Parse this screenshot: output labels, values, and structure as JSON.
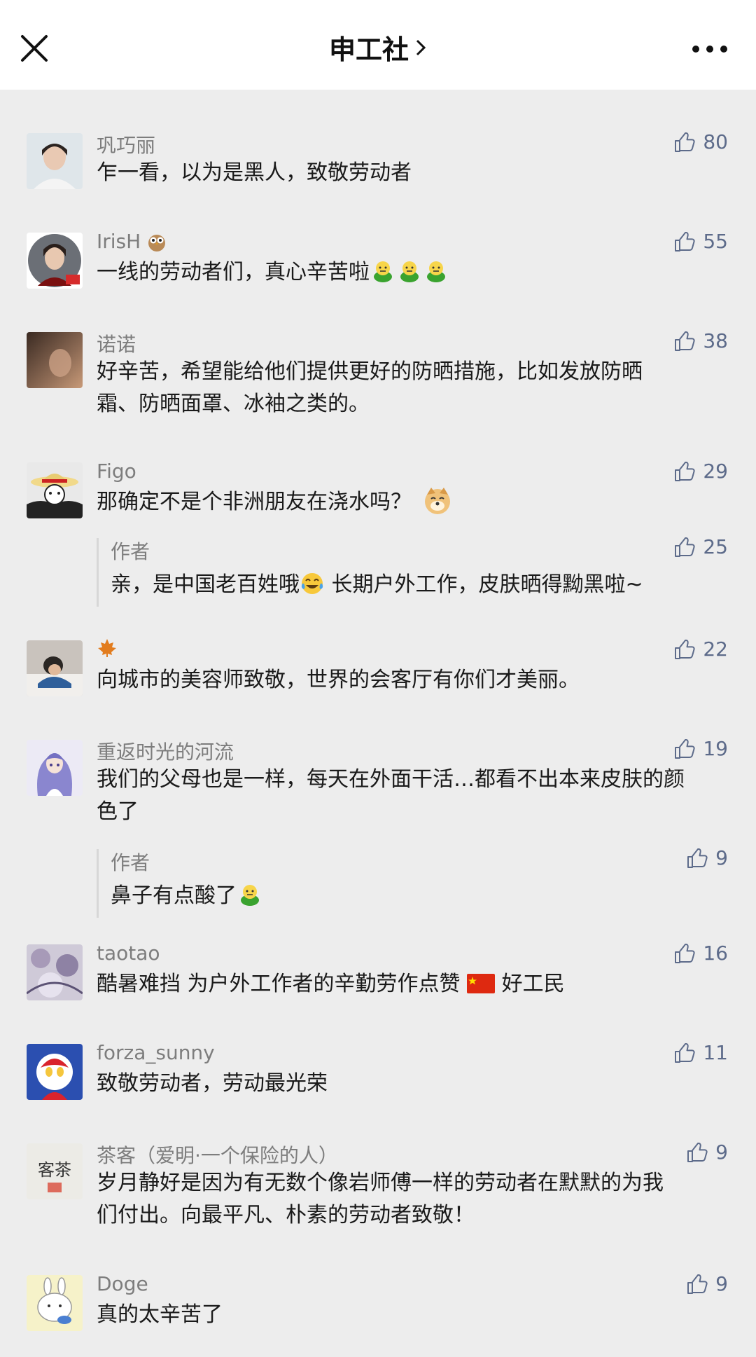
{
  "header": {
    "title": "申工社"
  },
  "comments": [
    {
      "name": "巩巧丽",
      "text": "乍一看，以为是黑人，致敬劳动者",
      "likes": "80"
    },
    {
      "name": "IrisH",
      "text": "一线的劳动者们，真心辛苦啦",
      "likes": "55"
    },
    {
      "name": "诺诺",
      "text1": "好辛苦，希望能给他们提供更好的防晒措施，比如发放防晒",
      "text2": "霜、防晒面罩、冰袖之类的。",
      "likes": "38"
    },
    {
      "name": "Figo",
      "text": "那确定不是个非洲朋友在浇水吗？",
      "likes": "29",
      "reply": {
        "name": "作者",
        "text_a": "亲，是中国老百姓哦",
        "text_b": " 长期户外工作，皮肤晒得黝黑啦~",
        "likes": "25"
      }
    },
    {
      "name": "",
      "text": "向城市的美容师致敬，世界的会客厅有你们才美丽。",
      "likes": "22"
    },
    {
      "name": "重返时光的河流",
      "text1": "我们的父母也是一样，每天在外面干活…都看不出本来皮肤的颜",
      "text2": "色了",
      "likes": "19",
      "reply": {
        "name": "作者",
        "text_a": "鼻子有点酸了",
        "likes": "9"
      }
    },
    {
      "name": "taotao",
      "text_a": "酷暑难挡 为户外工作者的辛勤劳作点赞 ",
      "text_b": " 好工民",
      "likes": "16"
    },
    {
      "name": "forza_sunny",
      "text": "致敬劳动者，劳动最光荣",
      "likes": "11"
    },
    {
      "name": "茶客（爱明·一个保险的人）",
      "text1": "岁月静好是因为有无数个像岩师傅一样的劳动者在默默的为我",
      "text2": "们付出。向最平凡、朴素的劳动者致敬！",
      "likes": "9",
      "avatar_text": "客茶"
    },
    {
      "name": "Doge",
      "text": "真的太辛苦了",
      "likes": "9"
    }
  ]
}
